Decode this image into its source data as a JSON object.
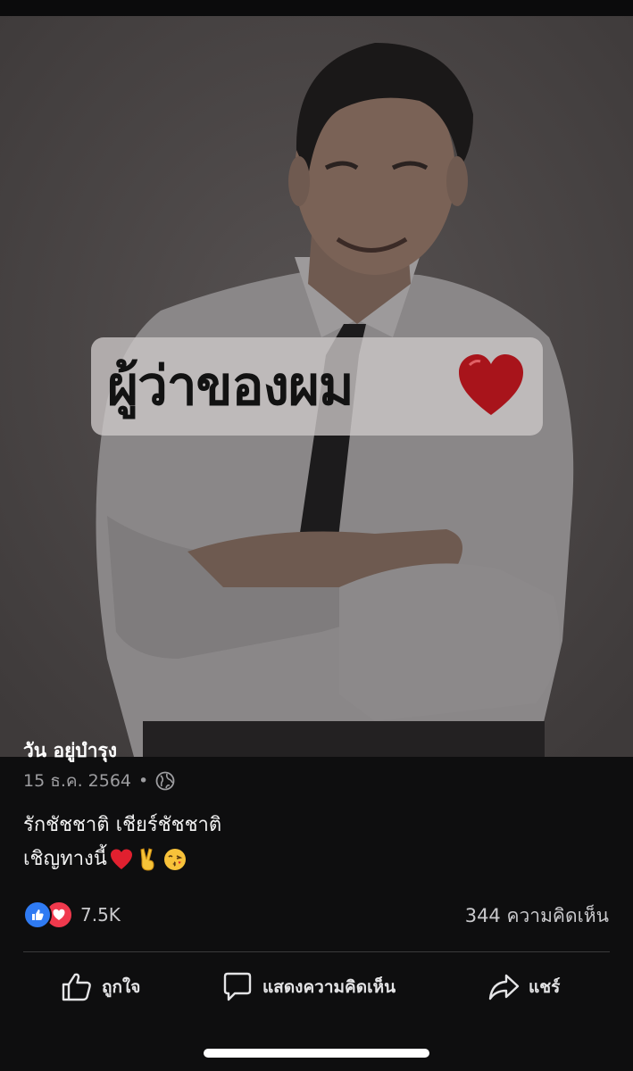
{
  "post": {
    "image_overlay_text": "ผู้ว่าของผม",
    "author": "วัน อยู่บำรุง",
    "date": "15 ธ.ค. 2564",
    "separator": "•",
    "privacy_icon": "globe-icon",
    "caption_line1": "รักชัชชาติ เชียร์ชัชชาติ",
    "caption_line2": "เชิญทางนี้",
    "caption_emojis": [
      "heart-emoji",
      "victory-hand-emoji",
      "kissing-face-emoji"
    ]
  },
  "stats": {
    "reaction_icons": [
      "like-reaction-icon",
      "love-reaction-icon"
    ],
    "reaction_count": "7.5K",
    "comment_count": "344 ความคิดเห็น"
  },
  "actions": {
    "like_label": "ถูกใจ",
    "comment_label": "แสดงความคิดเห็น",
    "share_label": "แชร์"
  },
  "colors": {
    "background": "#0e0e0f",
    "like_blue": "#2f7bf3",
    "love_red": "#f0394d",
    "secondary_text": "#9d9da0"
  }
}
